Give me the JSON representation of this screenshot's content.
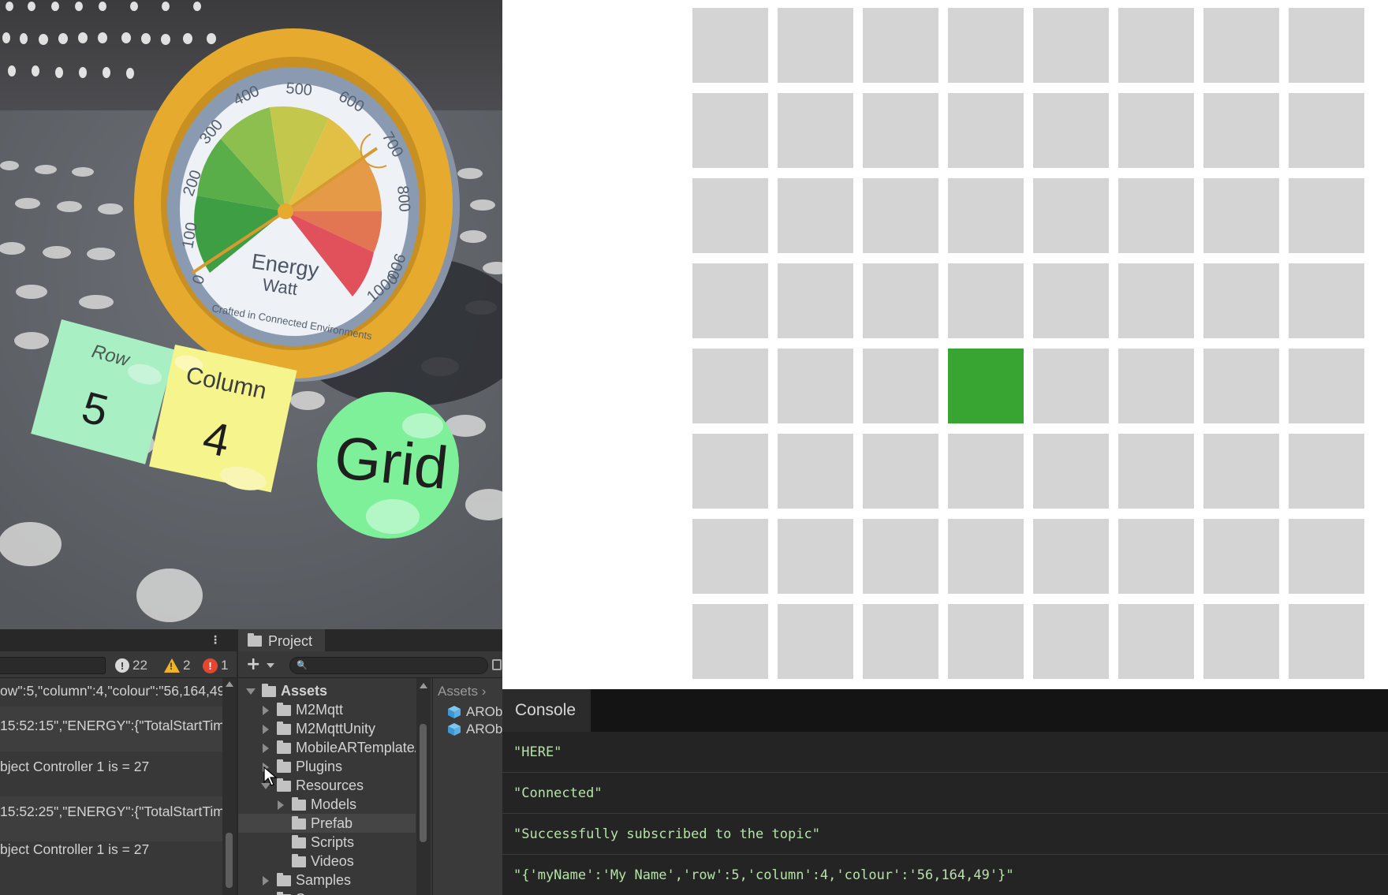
{
  "scene": {
    "gauge": {
      "ticks": [
        "0",
        "100",
        "200",
        "300",
        "400",
        "500",
        "600",
        "700",
        "800",
        "900",
        "1000"
      ],
      "title": "Energy",
      "unit": "Watt",
      "credit": "Crafted in Connected Environments",
      "needle_value": 640,
      "colors": {
        "ring": "#e6aa2e",
        "face": "#eef1f6",
        "low": "#3e9e44",
        "mid": "#c8c94a",
        "high": "#e0515c"
      }
    },
    "row_card": {
      "label": "Row",
      "value": "5",
      "color": "#a8f0c4"
    },
    "column_card": {
      "label": "Column",
      "value": "4",
      "color": "#f6f48c"
    },
    "grid_button": {
      "label": "Grid",
      "color": "#7ef09a"
    }
  },
  "unity_console": {
    "counts": {
      "info": "22",
      "warnings": "2",
      "errors": "1"
    },
    "logs": [
      "ow\":5,\"column\":4,\"colour\":\"56,164,49\"}",
      "15:52:15\",\"ENERGY\":{\"TotalStartTime",
      "bject Controller 1 is = 27",
      "15:52:25\",\"ENERGY\":{\"TotalStartTime",
      "bject Controller 1 is = 27"
    ]
  },
  "project": {
    "tab_label": "Project",
    "tree": [
      {
        "label": "Assets",
        "depth": 0,
        "expanded": true,
        "arrow": true
      },
      {
        "label": "M2Mqtt",
        "depth": 1,
        "expanded": false,
        "arrow": true
      },
      {
        "label": "M2MqttUnity",
        "depth": 1,
        "expanded": false,
        "arrow": true
      },
      {
        "label": "MobileARTemplateAssets",
        "depth": 1,
        "expanded": false,
        "arrow": true
      },
      {
        "label": "Plugins",
        "depth": 1,
        "expanded": false,
        "arrow": true
      },
      {
        "label": "Resources",
        "depth": 1,
        "expanded": true,
        "arrow": true
      },
      {
        "label": "Models",
        "depth": 2,
        "expanded": false,
        "arrow": true
      },
      {
        "label": "Prefab",
        "depth": 2,
        "expanded": false,
        "arrow": false,
        "selected": true
      },
      {
        "label": "Scripts",
        "depth": 2,
        "expanded": false,
        "arrow": false
      },
      {
        "label": "Videos",
        "depth": 2,
        "expanded": false,
        "arrow": false
      },
      {
        "label": "Samples",
        "depth": 1,
        "expanded": false,
        "arrow": true
      },
      {
        "label": "Scenes",
        "depth": 1,
        "expanded": false,
        "arrow": true
      }
    ],
    "breadcrumb": "Assets",
    "assets": [
      "ARObject",
      "ARObject"
    ]
  },
  "web_grid": {
    "rows": 8,
    "columns": 8,
    "active_row": 5,
    "active_column": 4,
    "active_color": "#38a431",
    "cell_color": "#d4d4d4"
  },
  "web_console": {
    "title": "Console",
    "messages": [
      "\"HERE\"",
      "\"Connected\"",
      "\"Successfully subscribed to the topic\"",
      "\"{'myName':'My Name','row':5,'column':4,'colour':'56,164,49'}\""
    ]
  }
}
